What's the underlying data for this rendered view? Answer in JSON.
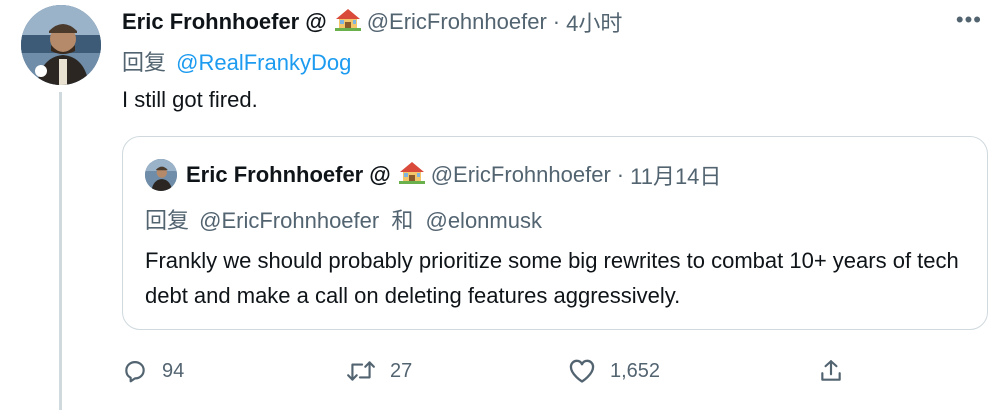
{
  "tweet": {
    "author_name": "Eric Frohnhoefer",
    "at_sign": "@",
    "handle": "@EricFrohnhoefer",
    "separator": "·",
    "time": "4小时",
    "reply_prefix": "回复",
    "reply_to": "@RealFrankyDog",
    "text": "I still got fired.",
    "more_icon": "more-icon"
  },
  "quote": {
    "author_name": "Eric Frohnhoefer",
    "at_sign": "@",
    "handle": "@EricFrohnhoefer",
    "separator": "·",
    "date": "11月14日",
    "reply_prefix": "回复",
    "reply_to_1": "@EricFrohnhoefer",
    "conjunction": "和",
    "reply_to_2": "@elonmusk",
    "text": "Frankly we should probably prioritize some big rewrites to combat 10+ years of tech debt and make a call on deleting features aggressively."
  },
  "actions": {
    "replies": "94",
    "retweets": "27",
    "likes": "1,652"
  },
  "colors": {
    "text": "#0f1419",
    "secondary": "#536471",
    "link": "#1d9bf0",
    "border": "#cfd9de"
  }
}
